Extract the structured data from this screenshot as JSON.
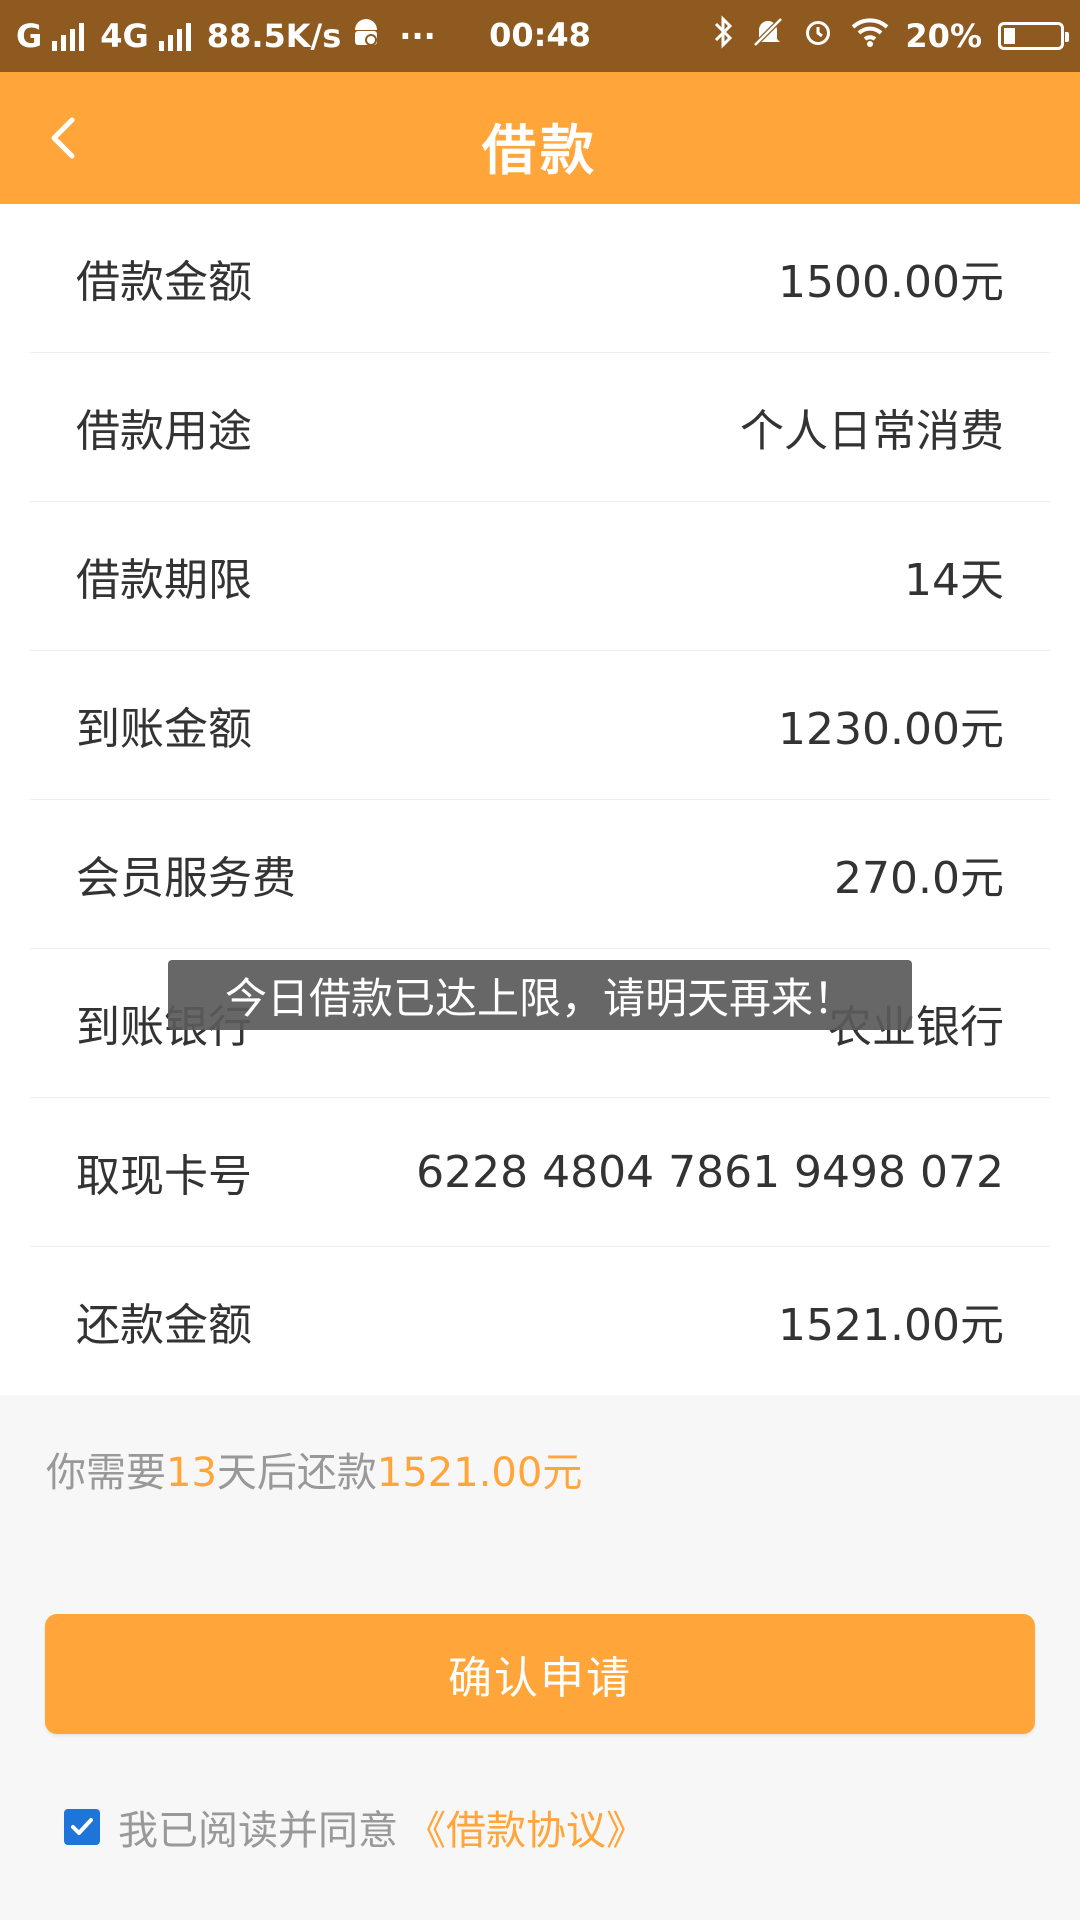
{
  "status_bar": {
    "carrier": "G",
    "network": "4G",
    "speed": "88.5K/s",
    "more": "···",
    "time": "00:48",
    "battery_text": "20%",
    "battery_level": 0.2
  },
  "header": {
    "title": "借款"
  },
  "rows": [
    {
      "label": "借款金额",
      "value": "1500.00元"
    },
    {
      "label": "借款用途",
      "value": "个人日常消费"
    },
    {
      "label": "借款期限",
      "value": "14天"
    },
    {
      "label": "到账金额",
      "value": "1230.00元"
    },
    {
      "label": "会员服务费",
      "value": "270.0元"
    },
    {
      "label": "到账银行",
      "value": "农业银行"
    },
    {
      "label": "取现卡号",
      "value": "6228 4804 7861 9498 072"
    },
    {
      "label": "还款金额",
      "value": "1521.00元"
    }
  ],
  "summary": {
    "prefix": "你需要",
    "days": "13",
    "middle": "天后还款",
    "amount": "1521.00元"
  },
  "confirm_button": "确认申请",
  "agreement": {
    "text": "我已阅读并同意",
    "link": "《借款协议》",
    "checked": true
  },
  "toast": "今日借款已达上限，请明天再来！",
  "colors": {
    "accent": "#ffa53a",
    "status_bar": "#8e5a20",
    "checkbox": "#1e74d8"
  }
}
